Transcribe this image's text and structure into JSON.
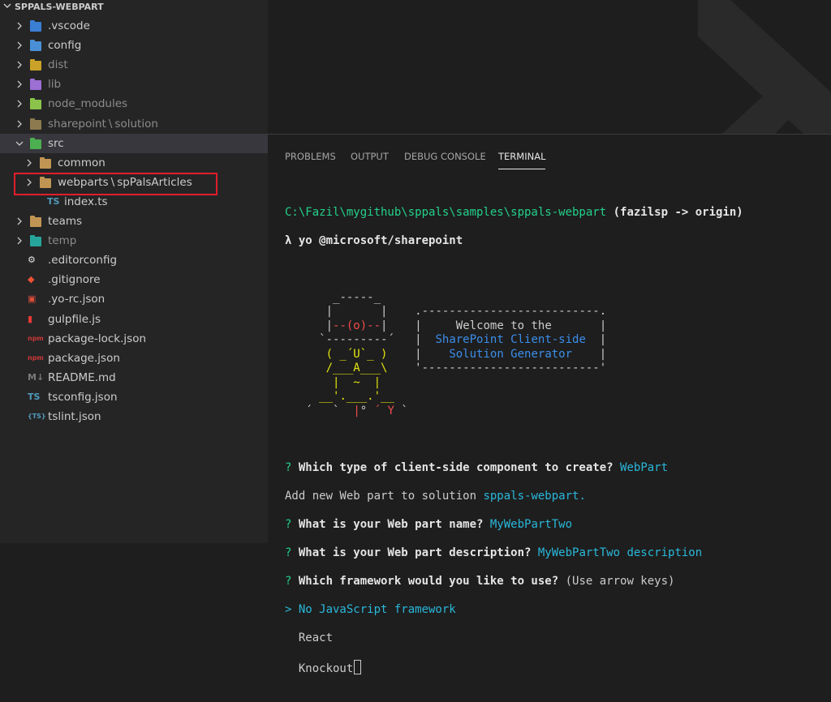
{
  "explorer": {
    "title": "SPPALS-WEBPART",
    "items": [
      {
        "label": ".vscode",
        "kind": "folder",
        "icon": "vscode-folder-icon",
        "color": "#3b7fd4",
        "expanded": false
      },
      {
        "label": "config",
        "kind": "folder",
        "icon": "config-folder-icon",
        "color": "#4a8fd6",
        "expanded": false
      },
      {
        "label": "dist",
        "kind": "folder",
        "icon": "dist-folder-icon",
        "color": "#c9a227",
        "expanded": false,
        "dim": true
      },
      {
        "label": "lib",
        "kind": "folder",
        "icon": "lib-folder-icon",
        "color": "#9b6fd4",
        "expanded": false,
        "dim": true
      },
      {
        "label": "node_modules",
        "kind": "folder",
        "icon": "node-modules-folder-icon",
        "color": "#8bc34a",
        "expanded": false,
        "dim": true
      },
      {
        "label": "sharepoint",
        "sep": "\\",
        "label2": "solution",
        "kind": "folder",
        "icon": "folder-icon",
        "color": "#8d7b4f",
        "expanded": false,
        "dim": true
      },
      {
        "label": "src",
        "kind": "folder",
        "icon": "src-folder-icon",
        "color": "#4caf50",
        "expanded": true
      },
      {
        "label": "common",
        "kind": "folder",
        "icon": "folder-icon",
        "color": "#c09553",
        "expanded": false
      },
      {
        "label": "webparts",
        "sep": "\\",
        "label2": "spPalsArticles",
        "kind": "folder",
        "icon": "folder-icon",
        "color": "#c09553",
        "expanded": false
      },
      {
        "label": "index.ts",
        "kind": "file",
        "icon": "typescript-icon",
        "glyph": "TS",
        "color": "#519aba"
      },
      {
        "label": "teams",
        "kind": "folder",
        "icon": "folder-icon",
        "color": "#c09553",
        "expanded": false
      },
      {
        "label": "temp",
        "kind": "folder",
        "icon": "temp-folder-icon",
        "color": "#26a69a",
        "expanded": false,
        "dim": true
      },
      {
        "label": ".editorconfig",
        "kind": "file",
        "icon": "editorconfig-icon",
        "glyph": "⚙",
        "color": "#e0e0e0"
      },
      {
        "label": ".gitignore",
        "kind": "file",
        "icon": "git-icon",
        "glyph": "◆",
        "color": "#f05033"
      },
      {
        "label": ".yo-rc.json",
        "kind": "file",
        "icon": "yeoman-icon",
        "glyph": "▣",
        "color": "#e04e39"
      },
      {
        "label": "gulpfile.js",
        "kind": "file",
        "icon": "gulp-icon",
        "glyph": "▮",
        "color": "#e53935"
      },
      {
        "label": "package-lock.json",
        "kind": "file",
        "icon": "npm-icon",
        "glyph": "npm",
        "color": "#cb3837"
      },
      {
        "label": "package.json",
        "kind": "file",
        "icon": "npm-icon",
        "glyph": "npm",
        "color": "#cb3837"
      },
      {
        "label": "README.md",
        "kind": "file",
        "icon": "markdown-icon",
        "glyph": "M↓",
        "color": "#7a7a7a"
      },
      {
        "label": "tsconfig.json",
        "kind": "file",
        "icon": "tsconfig-icon",
        "glyph": "TS",
        "color": "#519aba"
      },
      {
        "label": "tslint.json",
        "kind": "file",
        "icon": "json-icon",
        "glyph": "{TS}",
        "color": "#519aba"
      }
    ]
  },
  "panel": {
    "tabs": [
      "PROBLEMS",
      "OUTPUT",
      "DEBUG CONSOLE",
      "TERMINAL"
    ],
    "active_tab": "TERMINAL"
  },
  "terminal": {
    "path": "C:\\Fazil\\mygithub\\sppals\\samples\\sppals-webpart",
    "branch": "(fazilsp -> origin)",
    "command": "λ yo @microsoft/sharepoint",
    "banner": {
      "welcome": "Welcome to the",
      "line2": "SharePoint Client-side",
      "line3": "Solution Generator"
    },
    "q1": {
      "q": "? ",
      "text": "Which type of client-side component to create?",
      "answer": "WebPart"
    },
    "info": {
      "text": "Add new Web part to solution",
      "answer": "sppals-webpart."
    },
    "q2": {
      "q": "? ",
      "text": "What is your Web part name?",
      "answer": "MyWebPartTwo"
    },
    "q3": {
      "q": "? ",
      "text": "What is your Web part description?",
      "answer": "MyWebPartTwo description"
    },
    "q4": {
      "q": "? ",
      "text": "Which framework would you like to use?",
      "hint": "(Use arrow keys)"
    },
    "options": {
      "selected": "> No JavaScript framework",
      "opt2": "  React",
      "opt3": "  Knockout"
    }
  }
}
